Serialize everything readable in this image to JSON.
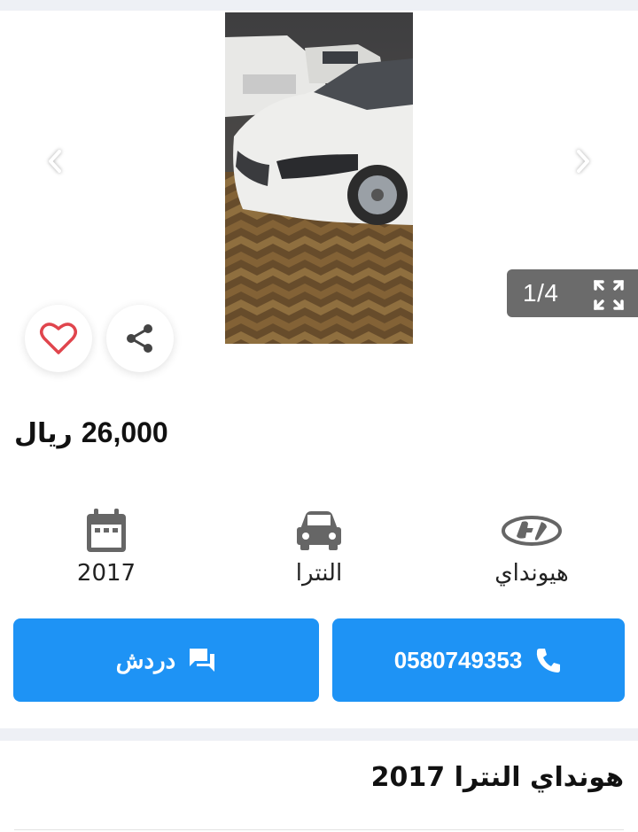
{
  "gallery": {
    "counter": "1/4",
    "prev_icon": "chevron-left-icon",
    "next_icon": "chevron-right-icon",
    "expand_icon": "expand-icon",
    "photo_description": "white car in parking lot"
  },
  "actions": {
    "favorite_icon": "heart-outline-icon",
    "share_icon": "share-icon"
  },
  "price": {
    "amount": "26,000",
    "currency": "ريال"
  },
  "specs": [
    {
      "icon": "hyundai-logo-icon",
      "label": "هيونداي"
    },
    {
      "icon": "car-icon",
      "label": "النترا"
    },
    {
      "icon": "calendar-icon",
      "label": "2017"
    }
  ],
  "buttons": {
    "call_number": "0580749353",
    "call_icon": "phone-icon",
    "chat_label": "دردش",
    "chat_icon": "chat-icon"
  },
  "listing": {
    "title": "هونداي النترا 2017"
  },
  "colors": {
    "accent": "#1e93f5",
    "heart": "#e0454d",
    "pill": "#6b6b6b",
    "separator": "#eef0f5"
  }
}
